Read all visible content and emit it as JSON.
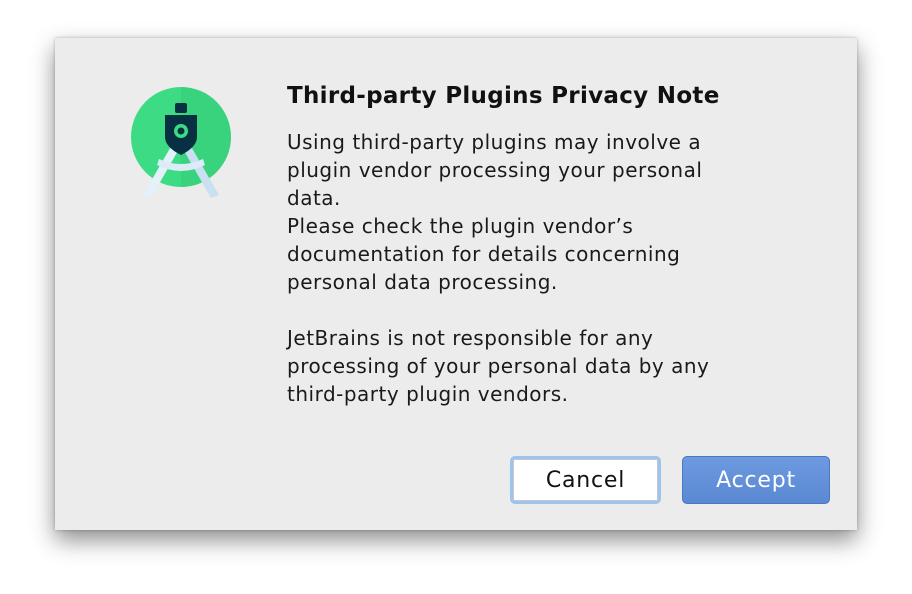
{
  "dialog": {
    "title": "Third-party Plugins Privacy Note",
    "paragraphs": [
      "Using third-party plugins may involve a plugin vendor processing your personal data.",
      "Please check the plugin vendor’s documentation for details concerning personal data processing.",
      "JetBrains is not responsible for any processing of your personal data by any third-party plugin vendors."
    ],
    "icon": "android-studio-icon",
    "buttons": {
      "cancel_label": "Cancel",
      "accept_label": "Accept"
    }
  },
  "colors": {
    "dialog_background": "#ececec",
    "accent": "#5a88d2",
    "focus_ring": "#9cc4f1",
    "icon_green": "#3ddc84"
  }
}
